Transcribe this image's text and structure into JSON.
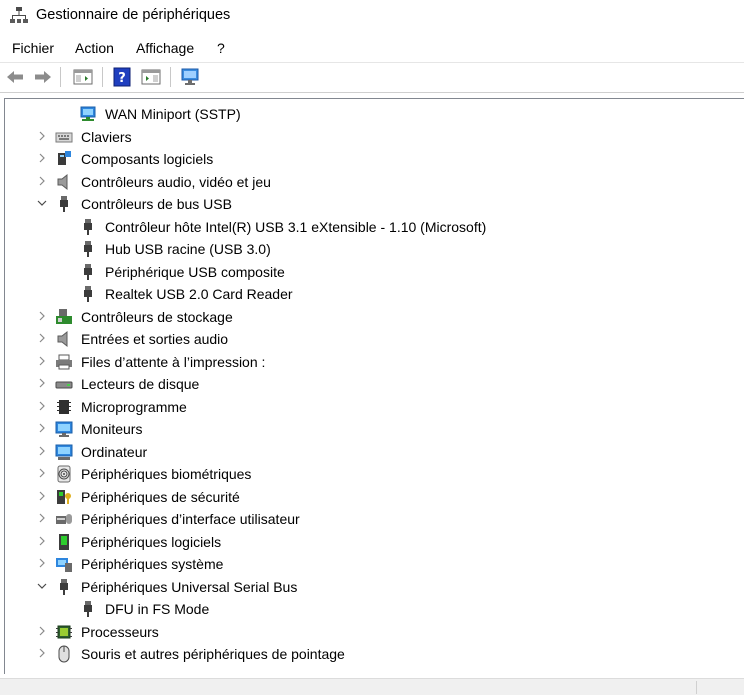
{
  "window": {
    "title": "Gestionnaire de périphériques"
  },
  "menu": {
    "items": [
      "Fichier",
      "Action",
      "Affichage",
      "?"
    ]
  },
  "toolbar": {
    "buttons": [
      "back-arrow-icon",
      "forward-arrow-icon",
      "show-hide-console-tree-icon",
      "help-icon",
      "properties-pane-icon",
      "scan-hardware-monitor-icon"
    ]
  },
  "tree": {
    "items": [
      {
        "label": "WAN Miniport (SSTP)",
        "level": 1,
        "expander": "none",
        "icon": "network-adapter-icon"
      },
      {
        "label": "Claviers",
        "level": 0,
        "expander": "collapsed",
        "icon": "keyboard-icon"
      },
      {
        "label": "Composants logiciels",
        "level": 0,
        "expander": "collapsed",
        "icon": "software-component-icon"
      },
      {
        "label": "Contrôleurs audio, vidéo et jeu",
        "level": 0,
        "expander": "collapsed",
        "icon": "speaker-icon"
      },
      {
        "label": "Contrôleurs de bus USB",
        "level": 0,
        "expander": "expanded",
        "icon": "usb-plug-icon"
      },
      {
        "label": "Contrôleur hôte Intel(R) USB 3.1 eXtensible - 1.10 (Microsoft)",
        "level": 1,
        "expander": "none",
        "icon": "usb-plug-icon"
      },
      {
        "label": "Hub USB racine (USB 3.0)",
        "level": 1,
        "expander": "none",
        "icon": "usb-plug-icon"
      },
      {
        "label": "Périphérique USB composite",
        "level": 1,
        "expander": "none",
        "icon": "usb-plug-icon"
      },
      {
        "label": "Realtek USB 2.0 Card Reader",
        "level": 1,
        "expander": "none",
        "icon": "usb-plug-icon"
      },
      {
        "label": "Contrôleurs de stockage",
        "level": 0,
        "expander": "collapsed",
        "icon": "storage-controller-icon"
      },
      {
        "label": "Entrées et sorties audio",
        "level": 0,
        "expander": "collapsed",
        "icon": "speaker-icon"
      },
      {
        "label": "Files d’attente à l’impression :",
        "level": 0,
        "expander": "collapsed",
        "icon": "printer-icon"
      },
      {
        "label": "Lecteurs de disque",
        "level": 0,
        "expander": "collapsed",
        "icon": "disk-drive-icon"
      },
      {
        "label": "Microprogramme",
        "level": 0,
        "expander": "collapsed",
        "icon": "firmware-chip-icon"
      },
      {
        "label": "Moniteurs",
        "level": 0,
        "expander": "collapsed",
        "icon": "monitor-icon"
      },
      {
        "label": "Ordinateur",
        "level": 0,
        "expander": "collapsed",
        "icon": "computer-icon"
      },
      {
        "label": "Périphériques biométriques",
        "level": 0,
        "expander": "collapsed",
        "icon": "fingerprint-icon"
      },
      {
        "label": "Périphériques de sécurité",
        "level": 0,
        "expander": "collapsed",
        "icon": "security-key-icon"
      },
      {
        "label": "Périphériques d’interface utilisateur",
        "level": 0,
        "expander": "collapsed",
        "icon": "hid-icon"
      },
      {
        "label": "Périphériques logiciels",
        "level": 0,
        "expander": "collapsed",
        "icon": "software-device-icon"
      },
      {
        "label": "Périphériques système",
        "level": 0,
        "expander": "collapsed",
        "icon": "system-device-icon"
      },
      {
        "label": "Périphériques Universal Serial Bus",
        "level": 0,
        "expander": "expanded",
        "icon": "usb-plug-icon"
      },
      {
        "label": "DFU in FS Mode",
        "level": 1,
        "expander": "none",
        "icon": "usb-plug-icon"
      },
      {
        "label": "Processeurs",
        "level": 0,
        "expander": "collapsed",
        "icon": "processor-icon"
      },
      {
        "label": "Souris et autres périphériques de pointage",
        "level": 0,
        "expander": "collapsed",
        "icon": "mouse-icon"
      }
    ]
  }
}
